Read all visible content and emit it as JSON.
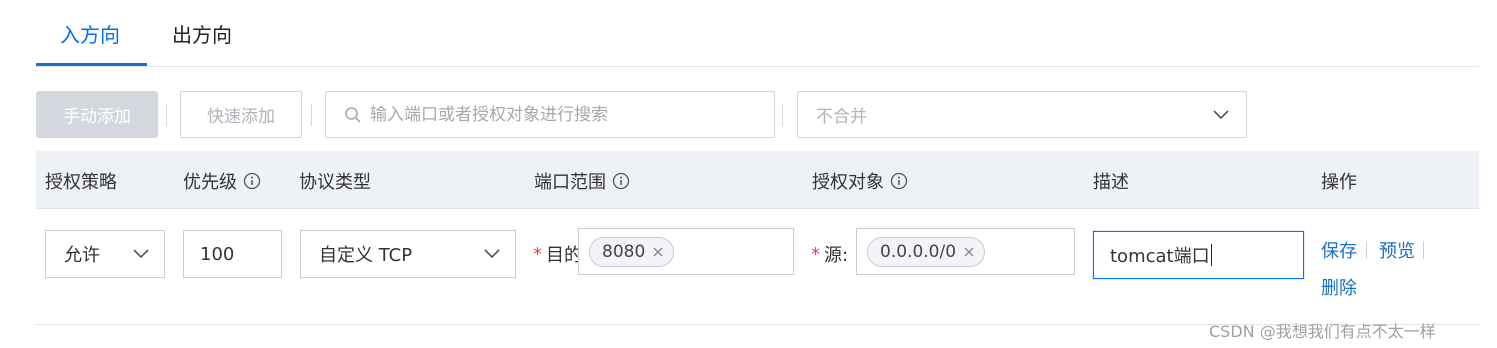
{
  "tabs": [
    {
      "label": "入方向",
      "active": true
    },
    {
      "label": "出方向",
      "active": false
    }
  ],
  "toolbar": {
    "manual_add": "手动添加",
    "quick_add": "快速添加",
    "search_placeholder": "输入端口或者授权对象进行搜索",
    "merge_select": "不合并"
  },
  "table": {
    "headers": [
      "授权策略",
      "优先级",
      "协议类型",
      "端口范围",
      "授权对象",
      "描述",
      "操作"
    ],
    "row": {
      "policy": "允许",
      "priority": "100",
      "protocol": "自定义 TCP",
      "port_label": "目的",
      "port_tag": "8080",
      "object_label": "源:",
      "object_tag": "0.0.0.0/0",
      "description": "tomcat端口",
      "actions": {
        "save": "保存",
        "preview": "预览",
        "delete": "删除"
      }
    }
  },
  "watermark": "CSDN @我想我们有点不太一样",
  "colors": {
    "accent": "#006eff",
    "link": "#1a6fc6",
    "required": "#e54545",
    "header_bg": "#eef1f5"
  }
}
